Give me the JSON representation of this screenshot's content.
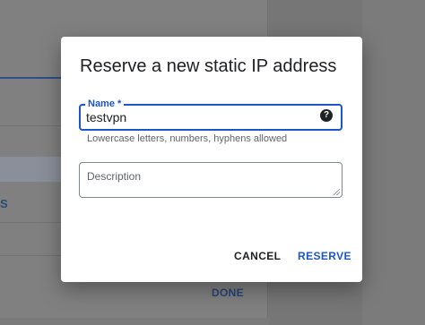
{
  "dialog": {
    "title": "Reserve a new static IP address",
    "name_field": {
      "label": "Name *",
      "value": "testvpn",
      "hint": "Lowercase letters, numbers, hyphens allowed",
      "help_icon": "help-circle-icon",
      "help_glyph": "?"
    },
    "description_field": {
      "placeholder": "Description",
      "value": ""
    },
    "buttons": {
      "cancel_label": "CANCEL",
      "reserve_label": "RESERVE"
    }
  },
  "background": {
    "partial_text": "S",
    "done_label": "DONE"
  },
  "colors": {
    "accent": "#1a56c8",
    "overlay": "#767676",
    "dialog_bg": "#ffffff"
  }
}
